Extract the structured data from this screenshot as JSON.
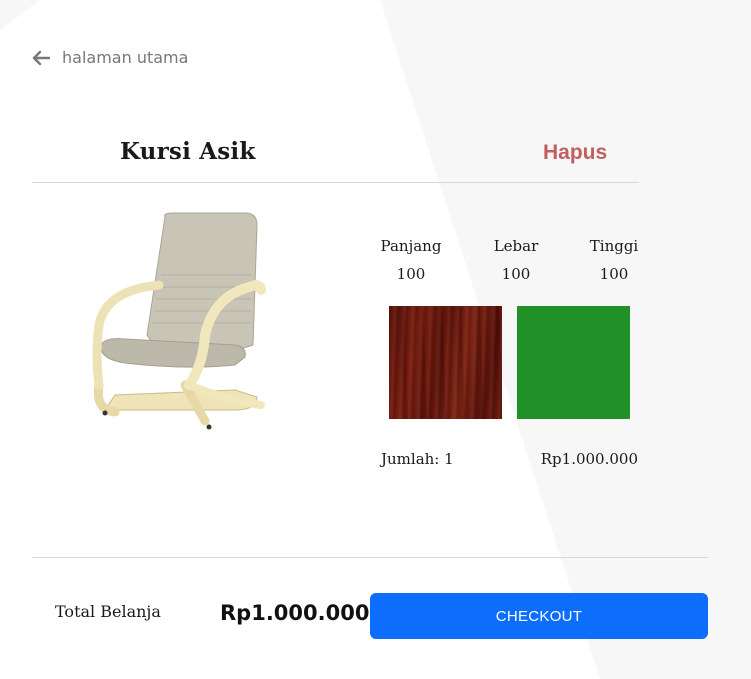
{
  "nav": {
    "back_label": "halaman utama",
    "back_icon": "arrow-left-icon"
  },
  "product": {
    "name": "Kursi Asik",
    "delete_label": "Hapus",
    "dimensions": [
      {
        "label": "Panjang",
        "value": "100"
      },
      {
        "label": "Lebar",
        "value": "100"
      },
      {
        "label": "Tinggi",
        "value": "100"
      }
    ],
    "swatches": [
      {
        "name": "wood",
        "color": "#6d1b0d"
      },
      {
        "name": "green",
        "color": "#219027"
      }
    ],
    "quantity_text": "Jumlah: 1",
    "price": "Rp1.000.000"
  },
  "summary": {
    "total_label": "Total Belanja",
    "total_amount": "Rp1.000.000",
    "checkout_label": "CHECKOUT"
  },
  "colors": {
    "accent": "#0d6efd",
    "delete": "#c0605e"
  }
}
